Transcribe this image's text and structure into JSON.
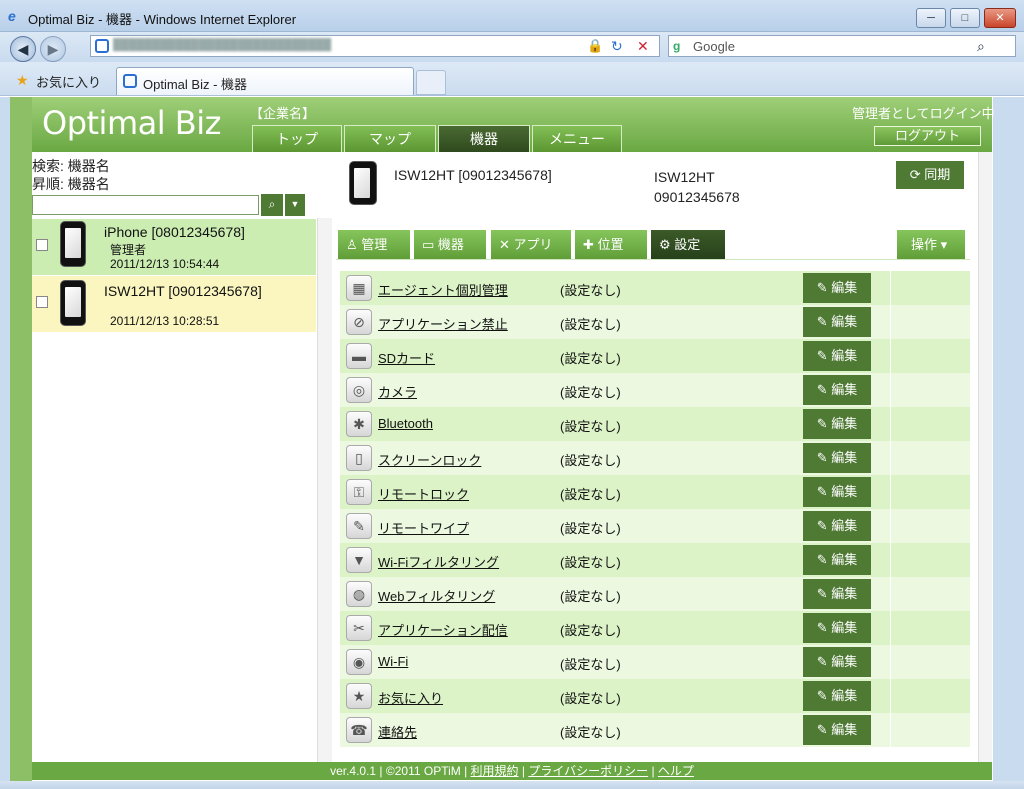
{
  "browser": {
    "window_title": "Optimal Biz - 機器 - Windows Internet Explorer",
    "search_engine": "Google",
    "favorites_label": "お気に入り",
    "tab_label": "Optimal Biz - 機器",
    "min_glyph": "─",
    "max_glyph": "□",
    "close_glyph": "✕",
    "back_glyph": "◀",
    "forward_glyph": "▶",
    "refresh_glyph": "↻",
    "stop_glyph": "✕",
    "lock_glyph": "🔒"
  },
  "header": {
    "logo": "Optimal Biz",
    "company": "【企業名】",
    "login_as": "管理者としてログイン中",
    "logout": "ログアウト",
    "tabs": [
      {
        "label": "トップ"
      },
      {
        "label": "マップ"
      },
      {
        "label": "機器",
        "active": true
      },
      {
        "label": "メニュー"
      }
    ]
  },
  "left": {
    "search_line1": "検索: 機器名",
    "search_line2": "昇順: 機器名",
    "search_glyph": "⌕",
    "dropdown_glyph": "▼",
    "devices": [
      {
        "name": "iPhone [08012345678]",
        "role": "管理者",
        "time": "2011/12/13 10:54:44"
      },
      {
        "name": "ISW12HT [09012345678]",
        "role": "",
        "time": "2011/12/13 10:28:51"
      }
    ]
  },
  "device": {
    "title": "ISW12HT [09012345678]",
    "model": "ISW12HT",
    "number": "09012345678",
    "sync": "⟳ 同期",
    "operate": "操作 ▾"
  },
  "subtabs": [
    {
      "label": "管理",
      "icon": "♙"
    },
    {
      "label": "機器",
      "icon": "▭"
    },
    {
      "label": "アプリ",
      "icon": "✕"
    },
    {
      "label": "位置",
      "icon": "✚"
    },
    {
      "label": "設定",
      "icon": "⚙",
      "active": true
    }
  ],
  "settings": [
    {
      "label": "エージェント個別管理",
      "value": "(設定なし)",
      "icon": "▦",
      "edit": "✎ 編集"
    },
    {
      "label": "アプリケーション禁止",
      "value": "(設定なし)",
      "icon": "⊘",
      "edit": "✎ 編集"
    },
    {
      "label": "SDカード",
      "value": "(設定なし)",
      "icon": "▬",
      "edit": "✎ 編集"
    },
    {
      "label": "カメラ",
      "value": "(設定なし)",
      "icon": "◎",
      "edit": "✎ 編集"
    },
    {
      "label": "Bluetooth",
      "value": "(設定なし)",
      "icon": "✱",
      "edit": "✎ 編集"
    },
    {
      "label": "スクリーンロック",
      "value": "(設定なし)",
      "icon": "▯",
      "edit": "✎ 編集"
    },
    {
      "label": "リモートロック",
      "value": "(設定なし)",
      "icon": "⚿",
      "edit": "✎ 編集"
    },
    {
      "label": "リモートワイプ",
      "value": "(設定なし)",
      "icon": "✎",
      "edit": "✎ 編集"
    },
    {
      "label": "Wi-Fiフィルタリング",
      "value": "(設定なし)",
      "icon": "▼",
      "edit": "✎ 編集"
    },
    {
      "label": "Webフィルタリング",
      "value": "(設定なし)",
      "icon": "◍",
      "edit": "✎ 編集"
    },
    {
      "label": "アプリケーション配信",
      "value": "(設定なし)",
      "icon": "✂",
      "edit": "✎ 編集"
    },
    {
      "label": "Wi-Fi",
      "value": "(設定なし)",
      "icon": "◉",
      "edit": "✎ 編集"
    },
    {
      "label": "お気に入り",
      "value": "(設定なし)",
      "icon": "★",
      "edit": "✎ 編集"
    },
    {
      "label": "連絡先",
      "value": "(設定なし)",
      "icon": "☎",
      "edit": "✎ 編集"
    }
  ],
  "footer": {
    "version": "ver.4.0.1 | ©2011 OPTiM | ",
    "terms": "利用規約",
    "privacy": "プライバシーポリシー",
    "help": "ヘルプ",
    "sep": " | "
  }
}
